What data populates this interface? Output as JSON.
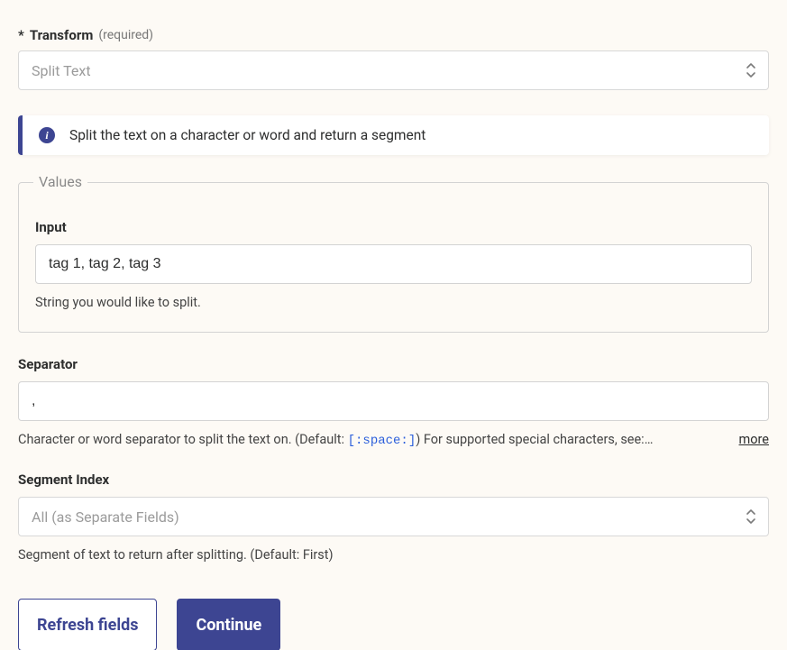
{
  "transform": {
    "asterisk": "*",
    "label": "Transform",
    "required": "(required)",
    "selected": "Split Text"
  },
  "banner": {
    "text": "Split the text on a character or word and return a segment"
  },
  "values": {
    "legend": "Values",
    "input": {
      "label": "Input",
      "value": "tag 1, tag 2, tag 3",
      "help": "String you would like to split."
    }
  },
  "separator": {
    "label": "Separator",
    "value": ",",
    "help_prefix": "Character or word separator to split the text on. (Default: ",
    "help_code": "[:space:]",
    "help_suffix": ") For supported special characters, see:…",
    "more": "more"
  },
  "segment": {
    "label": "Segment Index",
    "selected": "All (as Separate Fields)",
    "help": "Segment of text to return after splitting. (Default: First)"
  },
  "buttons": {
    "refresh": "Refresh fields",
    "continue": "Continue"
  }
}
